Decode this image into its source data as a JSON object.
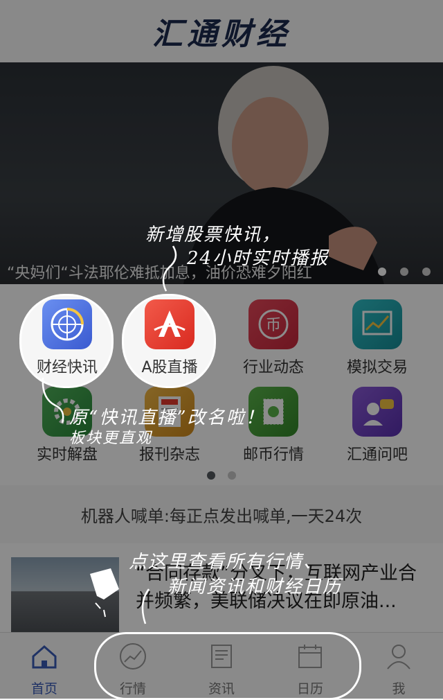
{
  "header": {
    "title": "汇通财经"
  },
  "banner": {
    "caption": "“央妈们“斗法耶伦难抵加息，油价恐难夕阳红",
    "dots": 3,
    "active_dot": 0
  },
  "grid": {
    "items": [
      {
        "label": "财经快讯",
        "icon": "radar-icon",
        "color": "#4a6fd8"
      },
      {
        "label": "A股直播",
        "icon": "a-share-icon",
        "color": "#e53a2c"
      },
      {
        "label": "行业动态",
        "icon": "yuan-coin-icon",
        "color": "#d8344a"
      },
      {
        "label": "模拟交易",
        "icon": "trend-chart-icon",
        "color": "#1fa6b0"
      },
      {
        "label": "实时解盘",
        "icon": "gear-chart-icon",
        "color": "#3a9a4a"
      },
      {
        "label": "报刊杂志",
        "icon": "magazine-icon",
        "color": "#e0a02c"
      },
      {
        "label": "邮币行情",
        "icon": "stamp-icon",
        "color": "#4aa03a"
      },
      {
        "label": "汇通问吧",
        "icon": "chat-person-icon",
        "color": "#7a4ac8"
      }
    ],
    "pages": 2,
    "active_page": 0
  },
  "robot": {
    "text": "机器人喊单:每正点发出喊单,一天24次"
  },
  "news": {
    "headline": "“合同存款”分叉下，互联网产业合并频繁，美联储决议在即原油..."
  },
  "tabs": [
    {
      "label": "首页",
      "icon": "home-icon",
      "active": true
    },
    {
      "label": "行情",
      "icon": "trend-icon",
      "active": false
    },
    {
      "label": "资讯",
      "icon": "news-icon",
      "active": false
    },
    {
      "label": "日历",
      "icon": "calendar-icon",
      "active": false
    },
    {
      "label": "我",
      "icon": "user-icon",
      "active": false
    }
  ],
  "tips": {
    "tip1_line1": "新增股票快讯，",
    "tip1_line2": "24小时实时播报",
    "tip2_line1": "原“快讯直播”改名啦！",
    "tip2_line2": "板块更直观",
    "tip3_line1": "点这里查看所有行情、",
    "tip3_line2": "新闻资讯和财经日历"
  },
  "colors": {
    "brand": "#1d2b4f",
    "accent": "#3a5bb8"
  }
}
